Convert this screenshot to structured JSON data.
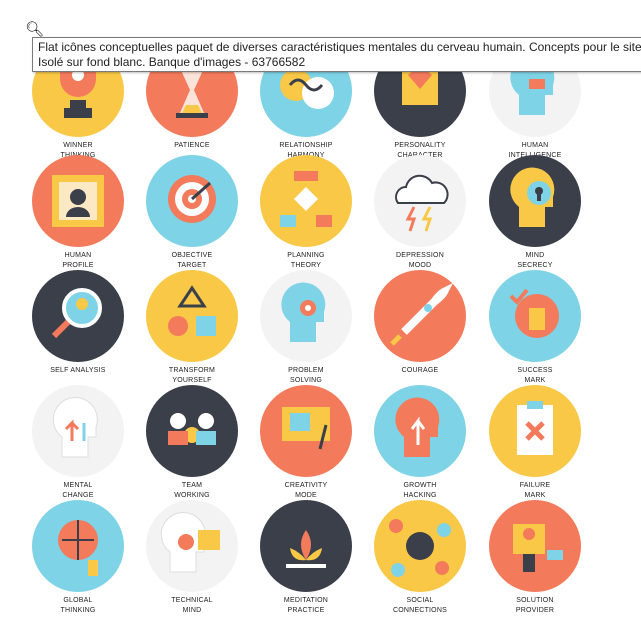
{
  "tooltip": {
    "line1": "Flat icônes conceptuelles paquet de diverses caractéristiques mentales du cerveau humain. Concepts pour le site W",
    "line2": "Isolé sur fond blanc. Banque d'images - 63766582"
  },
  "zoom_icon": "magnifier-plus-icon",
  "icons": [
    {
      "l1": "WINNER",
      "l2": "THINKING",
      "bg": "#f9c846",
      "kind": "trophy"
    },
    {
      "l1": "PATIENCE",
      "l2": "",
      "bg": "#f47a5c",
      "kind": "hourglass"
    },
    {
      "l1": "RELATIONSHIP",
      "l2": "HARMONY",
      "bg": "#7fd3e6",
      "kind": "harmony"
    },
    {
      "l1": "PERSONALITY",
      "l2": "CHARACTER",
      "bg": "#3a3f4a",
      "kind": "gem"
    },
    {
      "l1": "HUMAN",
      "l2": "INTELLIGENCE",
      "bg": "#f3f3f3",
      "kind": "head"
    },
    {
      "l1": "HUMAN",
      "l2": "PROFILE",
      "bg": "#f47a5c",
      "kind": "frame"
    },
    {
      "l1": "OBJECTIVE",
      "l2": "TARGET",
      "bg": "#7fd3e6",
      "kind": "target"
    },
    {
      "l1": "PLANNING",
      "l2": "THEORY",
      "bg": "#f9c846",
      "kind": "flow"
    },
    {
      "l1": "DEPRESSION",
      "l2": "MOOD",
      "bg": "#f3f3f3",
      "kind": "cloud"
    },
    {
      "l1": "MIND",
      "l2": "SECRECY",
      "bg": "#3a3f4a",
      "kind": "keyhole"
    },
    {
      "l1": "SELF ANALYSIS",
      "l2": "",
      "bg": "#3a3f4a",
      "kind": "magnifier"
    },
    {
      "l1": "TRANSFORM",
      "l2": "YOURSELF",
      "bg": "#f9c846",
      "kind": "shapes"
    },
    {
      "l1": "PROBLEM",
      "l2": "SOLVING",
      "bg": "#f3f3f3",
      "kind": "gearhead"
    },
    {
      "l1": "COURAGE",
      "l2": "",
      "bg": "#f47a5c",
      "kind": "rocket"
    },
    {
      "l1": "SUCCESS",
      "l2": "MARK",
      "bg": "#7fd3e6",
      "kind": "check"
    },
    {
      "l1": "MENTAL",
      "l2": "CHANGE",
      "bg": "#f3f3f3",
      "kind": "arrows"
    },
    {
      "l1": "TEAM",
      "l2": "WORKING",
      "bg": "#3a3f4a",
      "kind": "team"
    },
    {
      "l1": "CREATIVITY",
      "l2": "MODE",
      "bg": "#f47a5c",
      "kind": "easel"
    },
    {
      "l1": "GROWTH",
      "l2": "HACKING",
      "bg": "#7fd3e6",
      "kind": "growth"
    },
    {
      "l1": "FAILURE",
      "l2": "MARK",
      "bg": "#f9c846",
      "kind": "cross"
    },
    {
      "l1": "GLOBAL",
      "l2": "THINKING",
      "bg": "#7fd3e6",
      "kind": "brain"
    },
    {
      "l1": "TECHNICAL",
      "l2": "MIND",
      "bg": "#f3f3f3",
      "kind": "techhead"
    },
    {
      "l1": "MEDITATION",
      "l2": "PRACTICE",
      "bg": "#3a3f4a",
      "kind": "lotus"
    },
    {
      "l1": "SOCIAL",
      "l2": "CONNECTIONS",
      "bg": "#f9c846",
      "kind": "network"
    },
    {
      "l1": "SOLUTION",
      "l2": "PROVIDER",
      "bg": "#f47a5c",
      "kind": "provider"
    }
  ]
}
